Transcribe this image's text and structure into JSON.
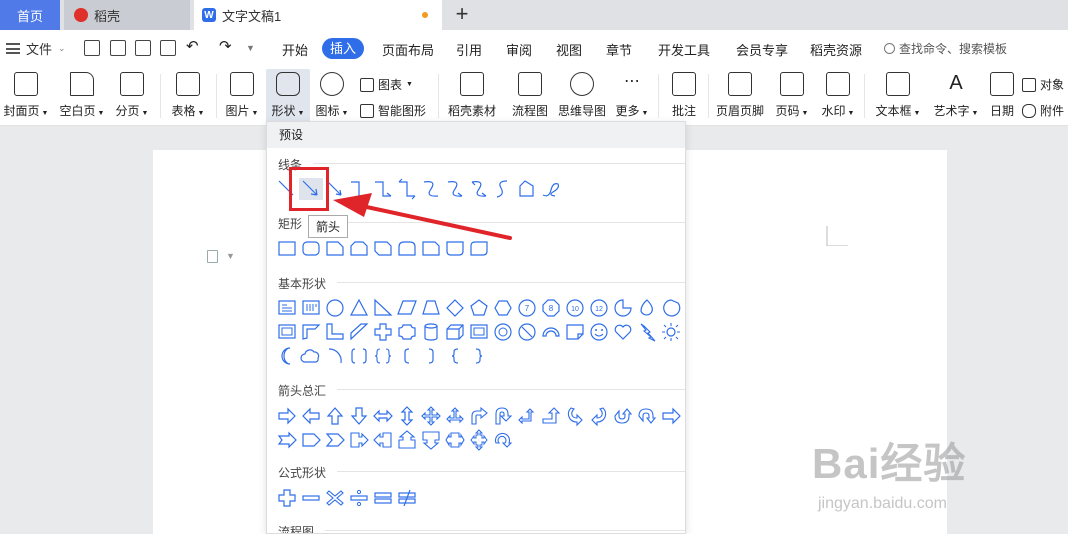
{
  "tabs": {
    "home": "首页",
    "daoke": "稻壳",
    "document": "文字文稿1"
  },
  "menubar": {
    "file": "文件",
    "items": [
      "开始",
      "插入",
      "页面布局",
      "引用",
      "审阅",
      "视图",
      "章节",
      "开发工具",
      "会员专享",
      "稻壳资源"
    ],
    "active": "插入",
    "search_placeholder": "查找命令、搜索模板"
  },
  "ribbon": {
    "cover": "封面页",
    "blank": "空白页",
    "pagebreak": "分页",
    "table": "表格",
    "picture": "图片",
    "shape": "形状",
    "icon": "图标",
    "chart": "图表",
    "smartart": "智能图形",
    "daoke_material": "稻壳素材",
    "flowchart": "流程图",
    "mindmap": "思维导图",
    "more": "更多",
    "comment": "批注",
    "header_footer": "页眉页脚",
    "page_number": "页码",
    "watermark": "水印",
    "textbox": "文本框",
    "wordart": "艺术字",
    "date": "日期",
    "object": "对象",
    "attachment": "附件"
  },
  "dropdown": {
    "header": "预设",
    "sections": {
      "lines": "线条",
      "rect": "矩形",
      "basic": "基本形状",
      "arrows": "箭头总汇",
      "formula": "公式形状",
      "flowchart": "流程图"
    },
    "tooltip": "箭头"
  },
  "watermark": {
    "brand": "Bai经验",
    "url": "jingyan.baidu.com"
  },
  "colors": {
    "accent": "#2f6ee8",
    "home_tab": "#4f7ae8",
    "highlight": "#e0252a",
    "shape_stroke": "#2f6ee8"
  }
}
